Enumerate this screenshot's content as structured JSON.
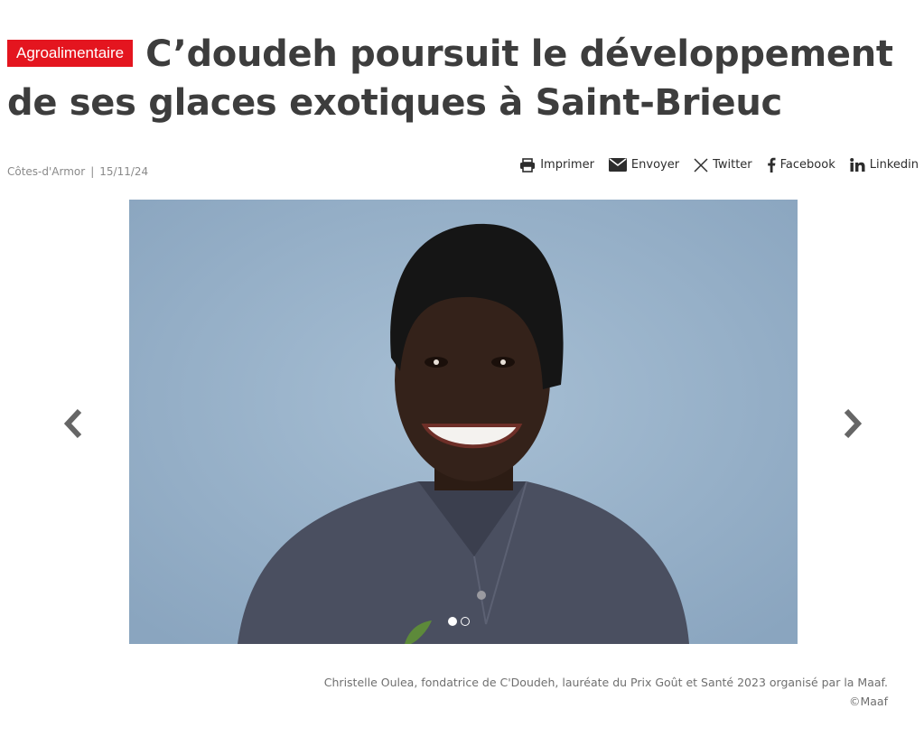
{
  "article": {
    "category": "Agroalimentaire",
    "title": "C’doudeh poursuit le développement de ses glaces exotiques à Saint-Brieuc",
    "location": "Côtes-d'Armor",
    "separator": "|",
    "date": "15/11/24"
  },
  "share": {
    "print_label": "Imprimer",
    "email_label": "Envoyer",
    "twitter_label": "Twitter",
    "facebook_label": "Facebook",
    "linkedin_label": "Linkedin"
  },
  "gallery": {
    "slide_count": 2,
    "active_slide": 1,
    "background_color": "#98b1c9"
  },
  "caption": {
    "text": "Christelle Oulea, fondatrice de C'Doudeh, lauréate du Prix Goût et Santé 2023 organisé par la Maaf.",
    "credit": "©Maaf"
  },
  "colors": {
    "accent": "#e4151f",
    "headline": "#3d3d3d",
    "meta": "#8a8a8a"
  },
  "icons": [
    "print-icon",
    "envelope-icon",
    "x-twitter-icon",
    "facebook-icon",
    "linkedin-icon",
    "chevron-left-icon",
    "chevron-right-icon"
  ]
}
